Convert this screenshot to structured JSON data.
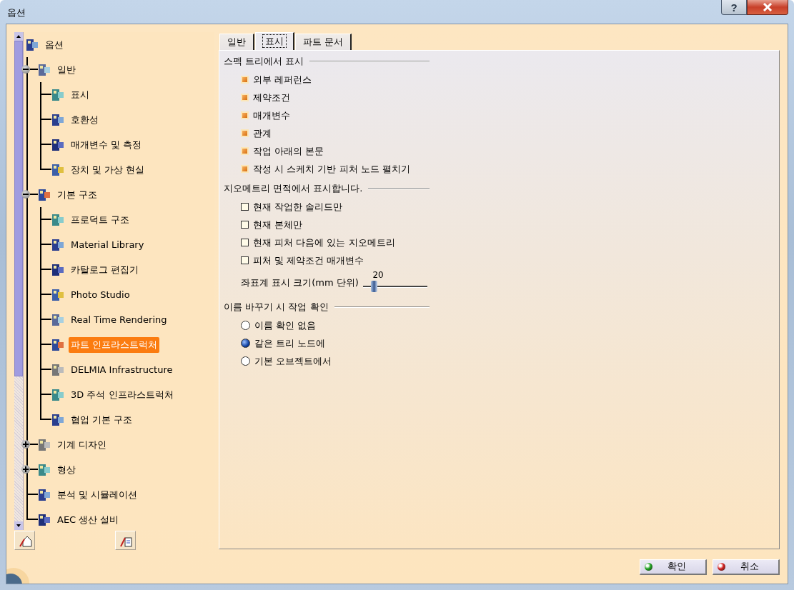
{
  "window": {
    "title": "옵션",
    "help_label": "?"
  },
  "tree": {
    "items": [
      {
        "label": "옵션",
        "selected": false,
        "children": [
          {
            "label": "일반",
            "selected": false,
            "expanded": true,
            "children": [
              {
                "label": "표시",
                "selected": false
              },
              {
                "label": "호환성",
                "selected": false
              },
              {
                "label": "매개변수 및 측정",
                "selected": false
              },
              {
                "label": "장치 및 가상 현실",
                "selected": false
              }
            ]
          },
          {
            "label": "기본 구조",
            "selected": false,
            "expanded": true,
            "children": [
              {
                "label": "프로덕트 구조",
                "selected": false
              },
              {
                "label": "Material Library",
                "selected": false
              },
              {
                "label": "카탈로그 편집기",
                "selected": false
              },
              {
                "label": "Photo Studio",
                "selected": false
              },
              {
                "label": "Real Time Rendering",
                "selected": false
              },
              {
                "label": "파트 인프라스트럭처",
                "selected": true
              },
              {
                "label": "DELMIA Infrastructure",
                "selected": false
              },
              {
                "label": "3D 주석 인프라스트럭처",
                "selected": false
              },
              {
                "label": "협업 기본 구조",
                "selected": false
              }
            ]
          },
          {
            "label": "기계 디자인",
            "selected": false,
            "expanded": false
          },
          {
            "label": "형상",
            "selected": false,
            "expanded": false
          },
          {
            "label": "분석 및 시뮬레이션",
            "selected": false
          },
          {
            "label": "AEC 생산 설비",
            "selected": false
          }
        ]
      }
    ]
  },
  "tabs": [
    {
      "label": "일반",
      "selected": false
    },
    {
      "label": "표시",
      "selected": true
    },
    {
      "label": "파트 문서",
      "selected": false
    }
  ],
  "sections": [
    {
      "title": "스펙 트리에서 표시",
      "items": [
        {
          "kind": "checkbox",
          "label": "외부 레퍼런스",
          "checked": true
        },
        {
          "kind": "checkbox",
          "label": "제약조건",
          "checked": true
        },
        {
          "kind": "checkbox",
          "label": "매개변수",
          "checked": true
        },
        {
          "kind": "checkbox",
          "label": "관계",
          "checked": true
        },
        {
          "kind": "checkbox",
          "label": "작업 아래의 본문",
          "checked": true
        },
        {
          "kind": "checkbox",
          "label": "작성 시 스케치 기반 피처 노드 펼치기",
          "checked": true
        }
      ]
    },
    {
      "title": "지오메트리 면적에서 표시합니다.",
      "items": [
        {
          "kind": "checkbox",
          "label": "현재 작업한 솔리드만",
          "checked": false
        },
        {
          "kind": "checkbox",
          "label": "현재 본체만",
          "checked": false
        },
        {
          "kind": "checkbox",
          "label": "현재 피처 다음에 있는 지오메트리",
          "checked": false
        },
        {
          "kind": "checkbox",
          "label": "피처 및 제약조건 매개변수",
          "checked": false
        },
        {
          "kind": "slider",
          "label": "좌표계 표시 크기(mm 단위)",
          "reading": "20",
          "level": 0.15
        }
      ]
    },
    {
      "title": "이름 바꾸기 시 작업 확인",
      "items": [
        {
          "kind": "radio",
          "label": "이름 확인 없음",
          "selected": false
        },
        {
          "kind": "radio",
          "label": "같은 트리 노드에",
          "selected": true
        },
        {
          "kind": "radio",
          "label": "기본 오브젝트에서",
          "selected": false
        }
      ]
    }
  ],
  "buttons": [
    {
      "kind": "ok",
      "label": "확인"
    },
    {
      "kind": "cancel",
      "label": "취소"
    }
  ]
}
